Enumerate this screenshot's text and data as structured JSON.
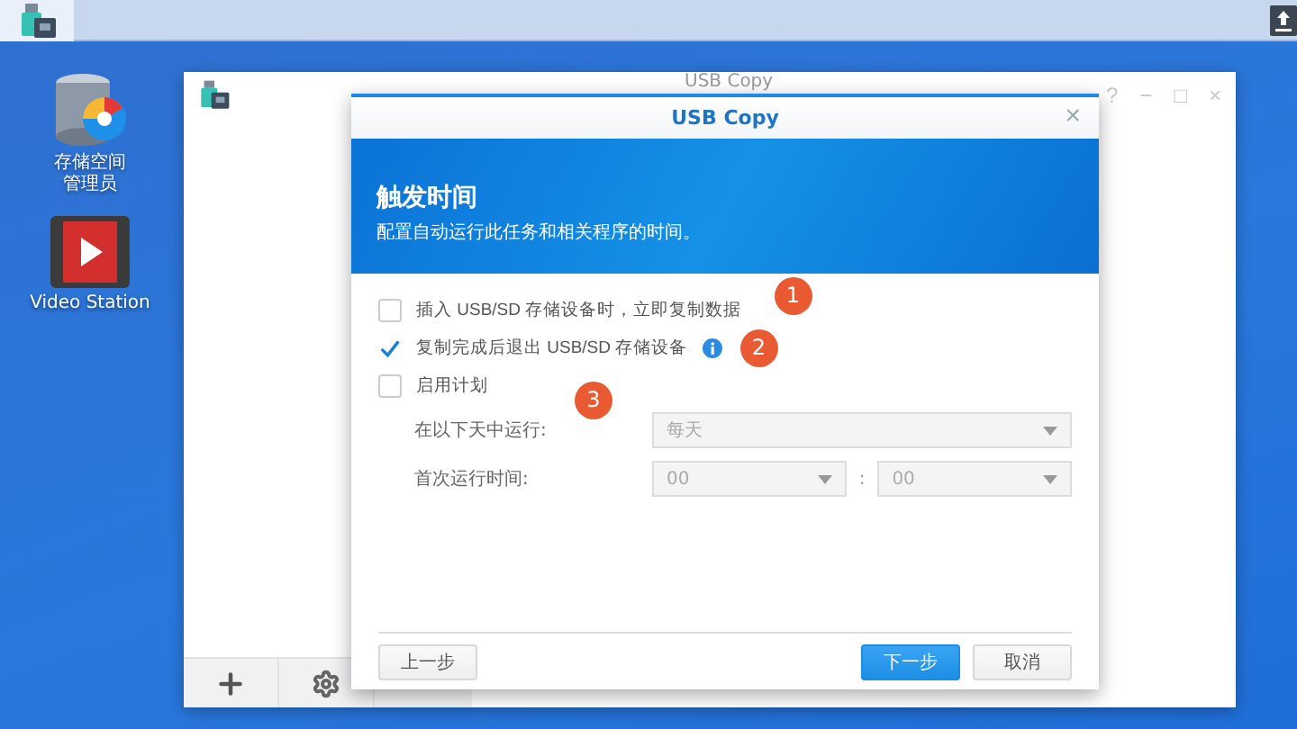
{
  "taskbar": {
    "apps": [
      {
        "kind": "usb-copy",
        "selected": true
      }
    ]
  },
  "desktop_icons": [
    {
      "kind": "storage",
      "label_lines": [
        "存储空间",
        "管理员"
      ]
    },
    {
      "kind": "video",
      "label_lines": [
        "Video Station"
      ]
    }
  ],
  "background_window": {
    "title": "USB Copy",
    "controls": [
      "?",
      "−",
      "□",
      "×"
    ]
  },
  "dialog": {
    "title": "USB Copy",
    "close": "×",
    "banner_title": "触发时间",
    "banner_subtitle": "配置自动运行此任务和相关程序的时间。",
    "options": [
      {
        "label": "插入 USB/SD 存储设备时，立即复制数据",
        "checked": false,
        "info": false
      },
      {
        "label": "复制完成后退出 USB/SD 存储设备",
        "checked": true,
        "info": true
      },
      {
        "label": "启用计划",
        "checked": false,
        "info": false
      }
    ],
    "schedule": {
      "disabled": true,
      "rows": [
        {
          "label": "在以下天中运行:",
          "selects": [
            "每天"
          ]
        },
        {
          "label": "首次运行时间:",
          "selects": [
            "00",
            "00"
          ],
          "separator": ":"
        }
      ]
    },
    "buttons": [
      {
        "label": "上一步",
        "kind": "secondary"
      },
      {
        "label": "下一步",
        "kind": "primary"
      },
      {
        "label": "取消",
        "kind": "secondary"
      }
    ]
  },
  "annotations": [
    "1",
    "2",
    "3"
  ]
}
